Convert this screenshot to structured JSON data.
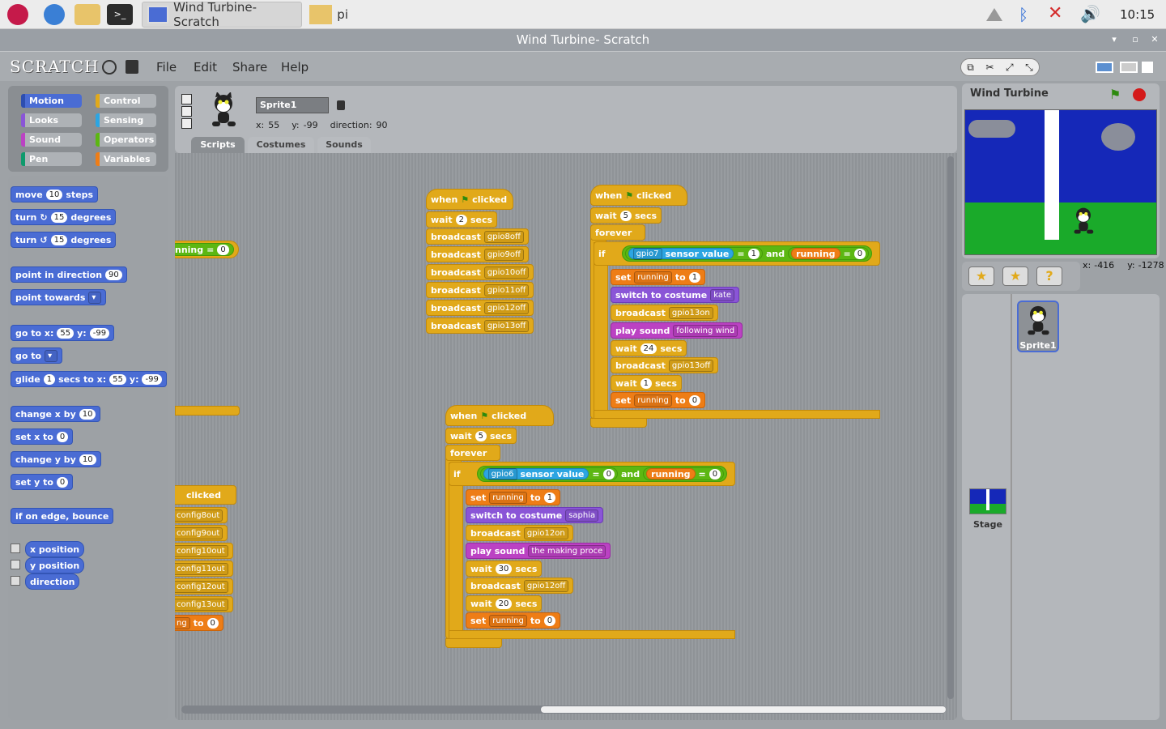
{
  "taskbar": {
    "task1": "Wind Turbine- Scratch",
    "task2": "pi",
    "clock": "10:15"
  },
  "window": {
    "title": "Wind Turbine- Scratch"
  },
  "menu": {
    "logo": "SCRATCH",
    "items": [
      "File",
      "Edit",
      "Share",
      "Help"
    ]
  },
  "categories": [
    "Motion",
    "Control",
    "Looks",
    "Sensing",
    "Sound",
    "Operators",
    "Pen",
    "Variables"
  ],
  "category_colors": {
    "Motion": "#4a6cd4",
    "Control": "#e1a91a",
    "Looks": "#8a55d7",
    "Sensing": "#2ca5e2",
    "Sound": "#bb42c3",
    "Operators": "#5cb712",
    "Pen": "#0e9a6c",
    "Variables": "#ee7d16"
  },
  "palette": {
    "move": [
      "move",
      "10",
      "steps"
    ],
    "turn_cw": [
      "turn",
      "15",
      "degrees"
    ],
    "turn_ccw": [
      "turn",
      "15",
      "degrees"
    ],
    "point_dir": [
      "point in direction",
      "90"
    ],
    "point_towards": [
      "point towards"
    ],
    "goto_xy": [
      "go to x:",
      "55",
      "y:",
      "-99"
    ],
    "goto": [
      "go to"
    ],
    "glide": [
      "glide",
      "1",
      "secs to x:",
      "55",
      "y:",
      "-99"
    ],
    "change_x": [
      "change x by",
      "10"
    ],
    "set_x": [
      "set x to",
      "0"
    ],
    "change_y": [
      "change y by",
      "10"
    ],
    "set_y": [
      "set y to",
      "0"
    ],
    "bounce": "if on edge, bounce",
    "xpos": "x position",
    "ypos": "y position",
    "direction": "direction"
  },
  "sprite": {
    "name": "Sprite1",
    "x_label": "x:",
    "x": "55",
    "y_label": "y:",
    "y": "-99",
    "dir_label": "direction:",
    "dir": "90"
  },
  "tabs": [
    "Scripts",
    "Costumes",
    "Sounds"
  ],
  "scripts": {
    "when": "when",
    "clicked": "clicked",
    "wait": "wait",
    "secs": "secs",
    "broadcast": "broadcast",
    "forever": "forever",
    "if": "if",
    "and": "and",
    "set": "set",
    "to": "to",
    "s1": {
      "wait": "2",
      "msgs": [
        "gpio8off",
        "gpio9off",
        "gpio10off",
        "gpio11off",
        "gpio12off",
        "gpio13off"
      ]
    },
    "s2": {
      "wait": "5",
      "sensor": "gpio7",
      "sensor_value": "sensor value",
      "eq1": "1",
      "running": "running",
      "eq2": "0",
      "set_val": "1",
      "costume_label": "switch to costume",
      "costume": "kate",
      "bc1": "gpio13on",
      "sound_label": "play sound",
      "sound": "following wind",
      "wait2": "24",
      "bc2": "gpio13off",
      "wait3": "1",
      "set_val2": "0"
    },
    "s3": {
      "wait": "5",
      "sensor": "gpio6",
      "sensor_value": "sensor value",
      "eq1": "0",
      "running": "running",
      "eq2": "0",
      "set_val": "1",
      "costume_label": "switch to costume",
      "costume": "saphia",
      "bc1": "gpio12on",
      "sound_label": "play sound",
      "sound": "the making proce",
      "wait2": "30",
      "bc2": "gpio12off",
      "wait3": "20",
      "set_val2": "0"
    },
    "partial": {
      "running": "nning",
      "eq": "=",
      "val": "0",
      "clicked": "clicked",
      "configs": [
        "config8out",
        "config9out",
        "config10out",
        "config11out",
        "config12out",
        "config13out"
      ],
      "ng": "ng",
      "to": "to",
      "zero": "0"
    }
  },
  "stage": {
    "title": "Wind Turbine",
    "mouse_x_label": "x:",
    "mouse_x": "-416",
    "mouse_y_label": "y:",
    "mouse_y": "-1278"
  },
  "sprites_list": [
    {
      "name": "Sprite1"
    }
  ],
  "stage_thumb": {
    "name": "Stage"
  }
}
